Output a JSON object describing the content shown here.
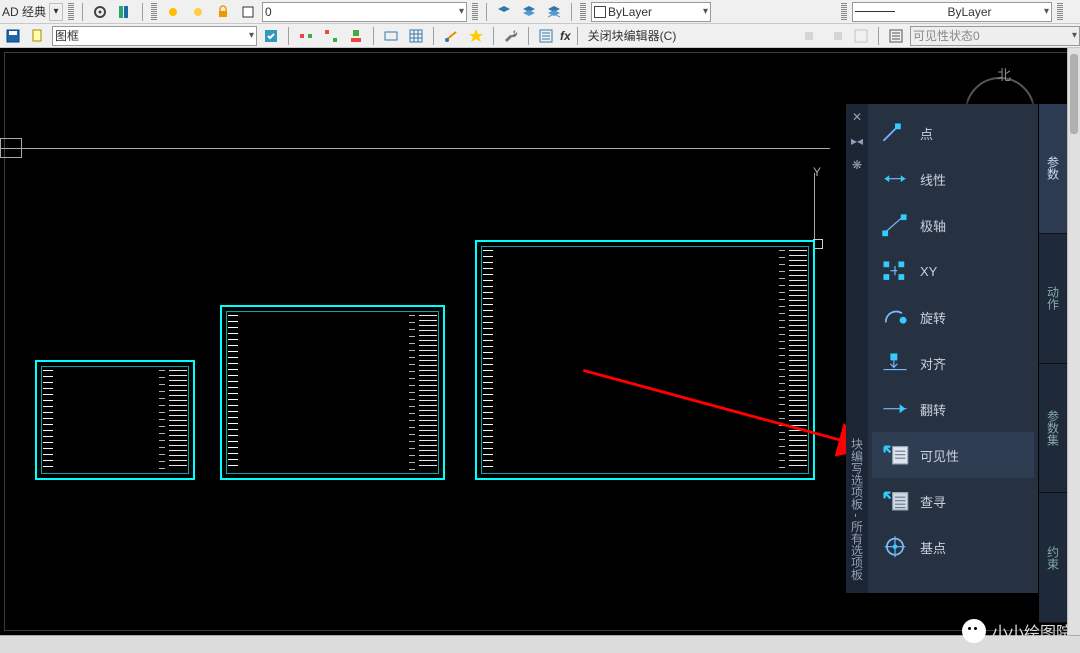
{
  "topbar": {
    "workspace_label": "AD 经典",
    "layer_value": "0",
    "prop_layer": "ByLayer",
    "prop_ltype": "ByLayer"
  },
  "blockbar": {
    "block_name": "图框",
    "fx": "fx",
    "close_editor": "关闭块编辑器(C)",
    "vis_state": "可见性状态0"
  },
  "palette": {
    "title_v": "块编写选项板 - 所有选项板",
    "items": [
      {
        "label": "点",
        "icon": "point"
      },
      {
        "label": "线性",
        "icon": "linear"
      },
      {
        "label": "极轴",
        "icon": "polar"
      },
      {
        "label": "XY",
        "icon": "xy"
      },
      {
        "label": "旋转",
        "icon": "rotate"
      },
      {
        "label": "对齐",
        "icon": "align"
      },
      {
        "label": "翻转",
        "icon": "flip"
      },
      {
        "label": "可见性",
        "icon": "visibility"
      },
      {
        "label": "查寻",
        "icon": "lookup"
      },
      {
        "label": "基点",
        "icon": "basepoint"
      }
    ],
    "tabs": [
      "参数",
      "动作",
      "参数集",
      "约束"
    ]
  },
  "canvas": {
    "y_label": "Y",
    "compass_n": "北"
  },
  "watermark": "小小绘图院"
}
